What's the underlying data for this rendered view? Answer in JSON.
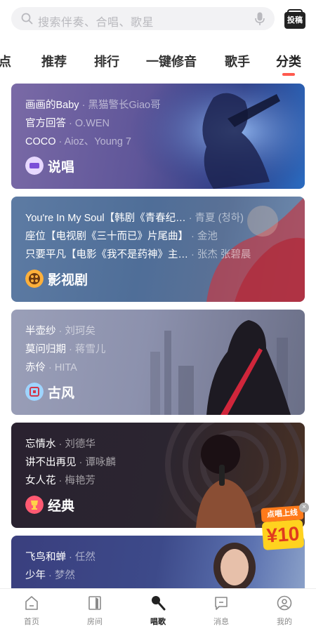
{
  "search": {
    "placeholder": "搜索伴奏、合唱、歌星",
    "submit_label": "投稿"
  },
  "tabs": [
    {
      "label": "点"
    },
    {
      "label": "推荐"
    },
    {
      "label": "排行"
    },
    {
      "label": "一键修音"
    },
    {
      "label": "歌手"
    },
    {
      "label": "分类",
      "active": true
    }
  ],
  "cards": [
    {
      "category": "说唱",
      "songs": [
        {
          "title": "画画的Baby",
          "artist": "· 黑猫警长Giao哥"
        },
        {
          "title": "官方回答",
          "artist": "· O.WEN"
        },
        {
          "title": "COCO",
          "artist": "· Aioz、Young 7"
        }
      ]
    },
    {
      "category": "影视剧",
      "songs": [
        {
          "title": "You're In My Soul【韩剧《青春纪…",
          "artist": "· 青夏 (청하)"
        },
        {
          "title": "座位【电视剧《三十而已》片尾曲】",
          "artist": "· 金池"
        },
        {
          "title": "只要平凡【电影《我不是药神》主…",
          "artist": "· 张杰 张碧晨"
        }
      ]
    },
    {
      "category": "古风",
      "songs": [
        {
          "title": "半壶纱",
          "artist": "· 刘珂矣"
        },
        {
          "title": "莫问归期",
          "artist": "· 蒋雪儿"
        },
        {
          "title": "赤伶",
          "artist": "· HITA"
        }
      ]
    },
    {
      "category": "经典",
      "songs": [
        {
          "title": "忘情水",
          "artist": "· 刘德华"
        },
        {
          "title": "讲不出再见",
          "artist": "· 谭咏麟"
        },
        {
          "title": "女人花",
          "artist": "· 梅艳芳"
        }
      ]
    },
    {
      "category": "",
      "songs": [
        {
          "title": "飞鸟和蝉",
          "artist": "· 任然"
        },
        {
          "title": "少年",
          "artist": "· 梦然"
        }
      ]
    }
  ],
  "promo": {
    "tag": "点唱上线",
    "amount": "¥10",
    "close_symbol": "×"
  },
  "bottom_nav": [
    {
      "label": "首页",
      "icon": "home-icon"
    },
    {
      "label": "房间",
      "icon": "room-door-icon"
    },
    {
      "label": "唱歌",
      "icon": "microphone-icon",
      "active": true
    },
    {
      "label": "消息",
      "icon": "message-icon"
    },
    {
      "label": "我的",
      "icon": "profile-icon"
    }
  ],
  "colors": {
    "accent": "#ff5a4e",
    "search_bg": "#f2f2f4",
    "rap_card": "#6b5a98",
    "film_card": "#4d6b95",
    "gufeng_card": "#8a8fa8",
    "classic_card": "#2a2231",
    "last_card": "#3b4a8a"
  }
}
